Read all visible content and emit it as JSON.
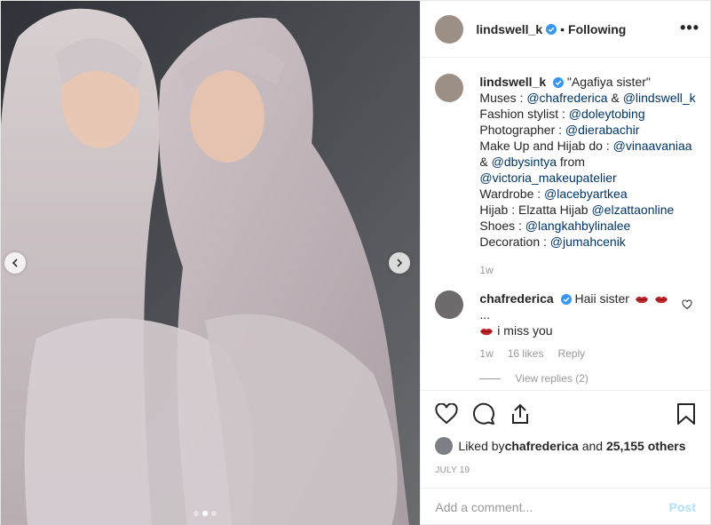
{
  "post": {
    "username": "lindswell_k",
    "follow_label": "Following",
    "bullet": "•",
    "more_label": "•••"
  },
  "caption": {
    "username": "lindswell_k",
    "lines": [
      "\"Agafiya sister\"",
      "Muses : ",
      "@chafrederica",
      " & ",
      "@lindswell_k",
      "Fashion stylist : ",
      "@doleytobing",
      "Photographer : ",
      "@dierabachir",
      "Make Up and Hijab do : ",
      "@vinaavaniaa",
      "& ",
      "@dbysintya",
      " from",
      "@victoria_makeupatelier",
      "Wardrobe : ",
      "@lacebyartkea",
      "Hijab : Elzatta Hijab ",
      "@elzattaonline",
      "Shoes : ",
      "@langkahbylinalee",
      "Decoration : ",
      "@jumahcenik"
    ],
    "time": "1w"
  },
  "reply": {
    "username": "chafrederica",
    "text1": "Haii sister",
    "ellipsis": "...",
    "text2": "i miss you",
    "time": "1w",
    "likes": "16 likes",
    "reply_label": "Reply",
    "view_replies": "View replies (2)"
  },
  "engagement": {
    "liked_by_prefix": "Liked by ",
    "liked_by_user": "chafrederica",
    "liked_by_and": " and ",
    "liked_by_count": "25,155 others",
    "date": "JULY 19"
  },
  "add_comment": {
    "placeholder": "Add a comment...",
    "post_label": "Post"
  },
  "colors": {
    "link": "#003569",
    "muted": "#999999",
    "verified": "#3897f0",
    "post_disabled": "#b2dffc"
  },
  "icons": [
    "chevron-left-icon",
    "chevron-right-icon",
    "verified-icon",
    "more-icon",
    "heart-icon",
    "comment-icon",
    "share-icon",
    "bookmark-icon",
    "lips-emoji-icon"
  ],
  "carousel": {
    "total": 3,
    "active": 2
  }
}
